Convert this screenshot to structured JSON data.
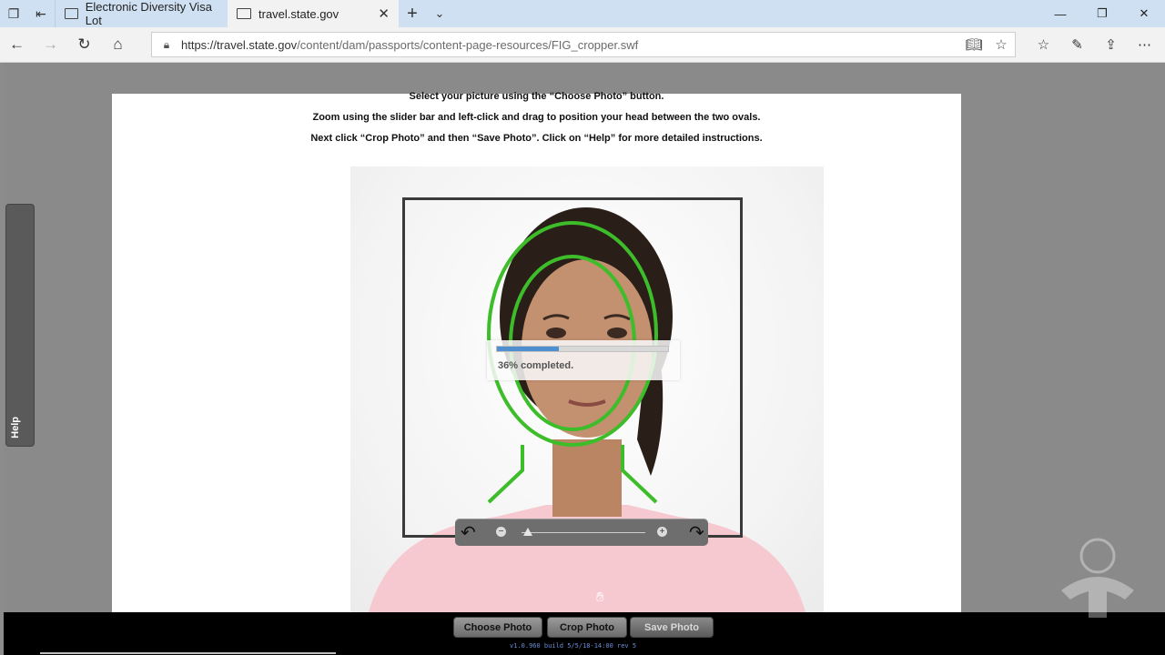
{
  "browser": {
    "tabs": [
      {
        "title": "Electronic Diversity Visa Lot",
        "active": false
      },
      {
        "title": "travel.state.gov",
        "active": true
      }
    ],
    "address": {
      "url_host": "https://travel.state.gov",
      "url_path": "/content/dam/passports/content-page-resources/FIG_cropper.swf"
    },
    "window_controls": {
      "minimize": "—",
      "restore": "❐",
      "close": "✕"
    },
    "nav_icons": {
      "back": "←",
      "forward": "→",
      "refresh": "↻",
      "home": "⌂"
    }
  },
  "cropper": {
    "instructions": [
      "Select your picture using the “Choose Photo” button.",
      "Zoom using the slider bar and left-click and drag to position your head between the two ovals.",
      "Next click “Crop Photo” and then “Save Photo”.  Click on “Help” for more detailed instructions."
    ],
    "progress": {
      "percent": 36,
      "label": "36% completed."
    },
    "zoom_level_fraction": 0.05,
    "help_label": "Help",
    "buttons": {
      "choose": "Choose Photo",
      "crop": "Crop Photo",
      "save": "Save Photo"
    },
    "build": "v1.0.960 build 5/5/18-14:00 rev 5",
    "overlay_color": "#3dbd2a",
    "progress_color": "#4f8fd0"
  }
}
